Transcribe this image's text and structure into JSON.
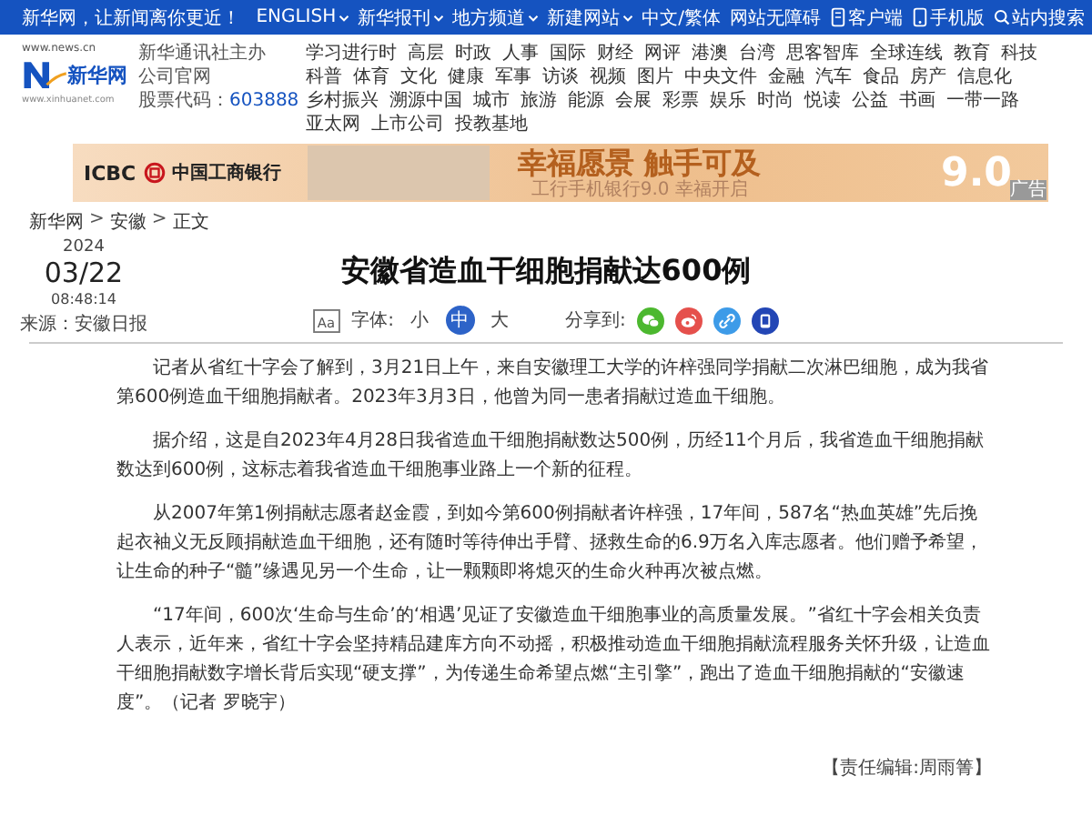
{
  "top_bar": {
    "slogan": "新华网，让新闻离你更近！",
    "links": [
      {
        "label": "ENGLISH",
        "dropdown": true
      },
      {
        "label": "新华报刊",
        "dropdown": true
      },
      {
        "label": "地方频道",
        "dropdown": true
      },
      {
        "label": "新建网站",
        "dropdown": true
      },
      {
        "label": "中文/繁体",
        "dropdown": false
      },
      {
        "label": "网站无障碍",
        "dropdown": false
      }
    ],
    "apps": [
      {
        "label": "客户端",
        "kind": "phone"
      },
      {
        "label": "手机版",
        "kind": "mobile"
      },
      {
        "label": "站内搜索",
        "kind": "search"
      }
    ]
  },
  "header": {
    "logo": {
      "domain": "www.news.cn",
      "name": "新华网",
      "site": "www.xinhuanet.com"
    },
    "org": [
      "新华通讯社主办",
      "公司官网"
    ],
    "stock_label": "股票代码：",
    "stock_code": "603888",
    "nav": [
      "学习进行时",
      "高层",
      "时政",
      "人事",
      "国际",
      "财经",
      "网评",
      "港澳",
      "台湾",
      "思客智库",
      "全球连线",
      "教育",
      "科技",
      "科普",
      "体育",
      "文化",
      "健康",
      "军事",
      "访谈",
      "视频",
      "图片",
      "中央文件",
      "金融",
      "汽车",
      "食品",
      "房产",
      "信息化",
      "乡村振兴",
      "溯源中国",
      "城市",
      "旅游",
      "能源",
      "会展",
      "彩票",
      "娱乐",
      "时尚",
      "悦读",
      "公益",
      "书画",
      "一带一路",
      "亚太网",
      "上市公司",
      "投教基地"
    ]
  },
  "ad": {
    "brand": "ICBC",
    "bank": "中国工商银行",
    "headline": "幸福愿景 触手可及",
    "subline": "工行手机银行9.0 幸福开启",
    "version": "9.0",
    "tag": "广告"
  },
  "breadcrumb": {
    "items": [
      "新华网",
      "安徽",
      "正文"
    ],
    "separator": ">"
  },
  "article": {
    "year": "2024",
    "date": "03/22",
    "time": "08:48:14",
    "source": "来源：安徽日报",
    "title": "安徽省造血干细胞捐献达600例",
    "font_size": {
      "icon_text": "Aa",
      "label": "字体:",
      "sizes": [
        {
          "label": "小",
          "selected": false
        },
        {
          "label": "中",
          "selected": true
        },
        {
          "label": "大",
          "selected": false
        }
      ]
    },
    "share": {
      "label": "分享到:",
      "targets": [
        {
          "kind": "wechat",
          "color": "#4cb82f"
        },
        {
          "kind": "weibo",
          "color": "#e5504c"
        },
        {
          "kind": "link",
          "color": "#3d9be8"
        },
        {
          "kind": "qzone",
          "color": "#2346b5"
        }
      ]
    },
    "paragraphs": [
      "记者从省红十字会了解到，3月21日上午，来自安徽理工大学的许梓强同学捐献二次淋巴细胞，成为我省第600例造血干细胞捐献者。2023年3月3日，他曾为同一患者捐献过造血干细胞。",
      "据介绍，这是自2023年4月28日我省造血干细胞捐献数达500例，历经11个月后，我省造血干细胞捐献数达到600例，这标志着我省造血干细胞事业路上一个新的征程。",
      "从2007年第1例捐献志愿者赵金霞，到如今第600例捐献者许梓强，17年间，587名“热血英雄”先后挽起衣袖义无反顾捐献造血干细胞，还有随时等待伸出手臂、拯救生命的6.9万名入库志愿者。他们赠予希望，让生命的种子“髓”缘遇见另一个生命，让一颗颗即将熄灭的生命火种再次被点燃。",
      "“17年间，600次‘生命与生命’的‘相遇’见证了安徽造血干细胞事业的高质量发展。”省红十字会相关负责人表示，近年来，省红十字会坚持精品建库方向不动摇，积极推动造血干细胞捐献流程服务关怀升级，让造血干细胞捐献数字增长背后实现“硬支撑”，为传递生命希望点燃“主引擎”，跑出了造血干细胞捐献的“安徽速度”。（记者 罗晓宇）"
    ],
    "editor": "【责任编辑:周雨箐】"
  }
}
